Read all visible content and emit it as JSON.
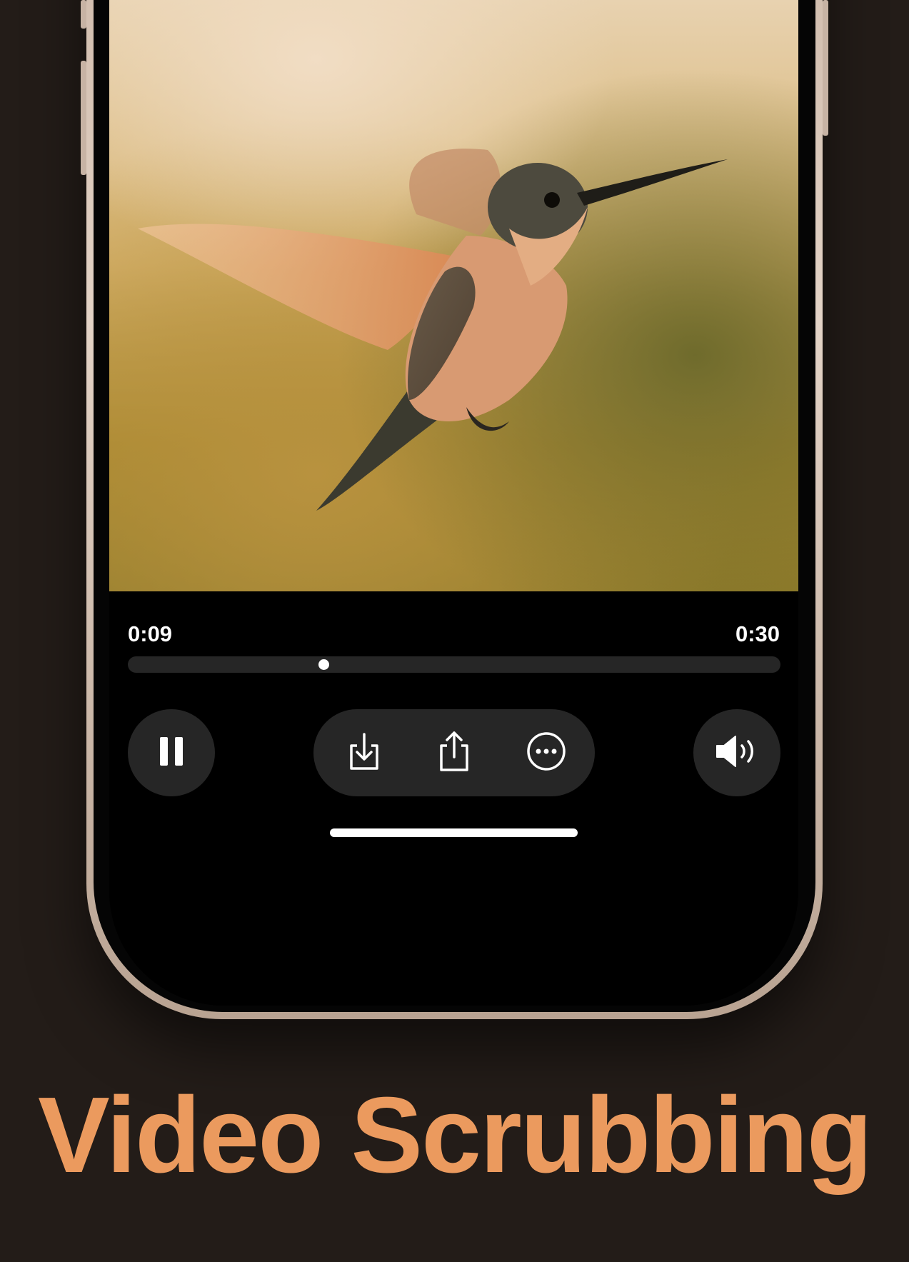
{
  "player": {
    "current_time": "0:09",
    "total_time": "0:30",
    "progress": 0.3,
    "video_subject": "hummingbird"
  },
  "controls": {
    "play_state": "playing",
    "icons": [
      "pause-icon",
      "download-icon",
      "share-icon",
      "more-icon",
      "volume-icon"
    ]
  },
  "title": "Video Scrubbing",
  "colors": {
    "background": "#231c18",
    "title": "#eb9a5e",
    "control_bg": "#262626",
    "screen": "#000000",
    "frame": "#d9c6b8"
  }
}
